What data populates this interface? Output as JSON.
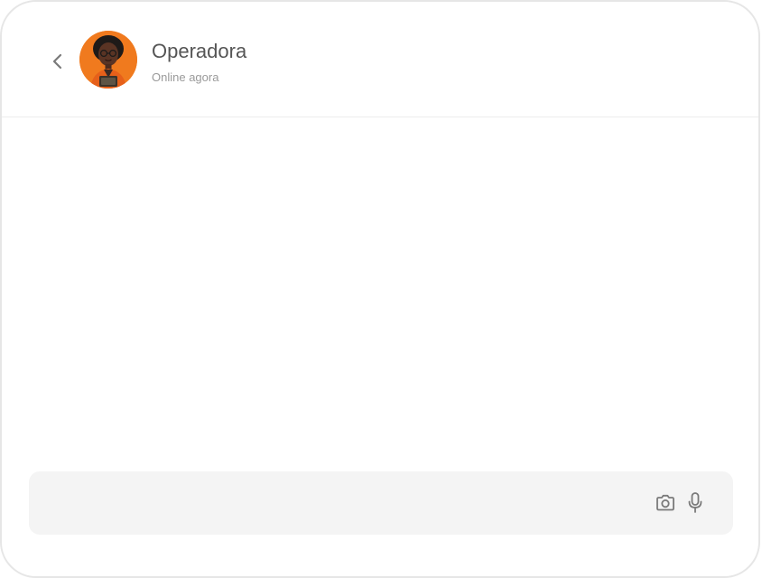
{
  "header": {
    "back_icon": "chevron-left-icon",
    "contact_name": "Operadora",
    "contact_status": "Online agora",
    "avatar_color": "#f07a1e"
  },
  "composer": {
    "placeholder": "",
    "value": "",
    "camera_icon": "camera-icon",
    "mic_icon": "microphone-icon"
  },
  "colors": {
    "background": "#ffffff",
    "composer_bg": "#f4f4f4",
    "icon": "#7a7a7a",
    "name_text": "#555555",
    "status_text": "#9a9a9a"
  }
}
